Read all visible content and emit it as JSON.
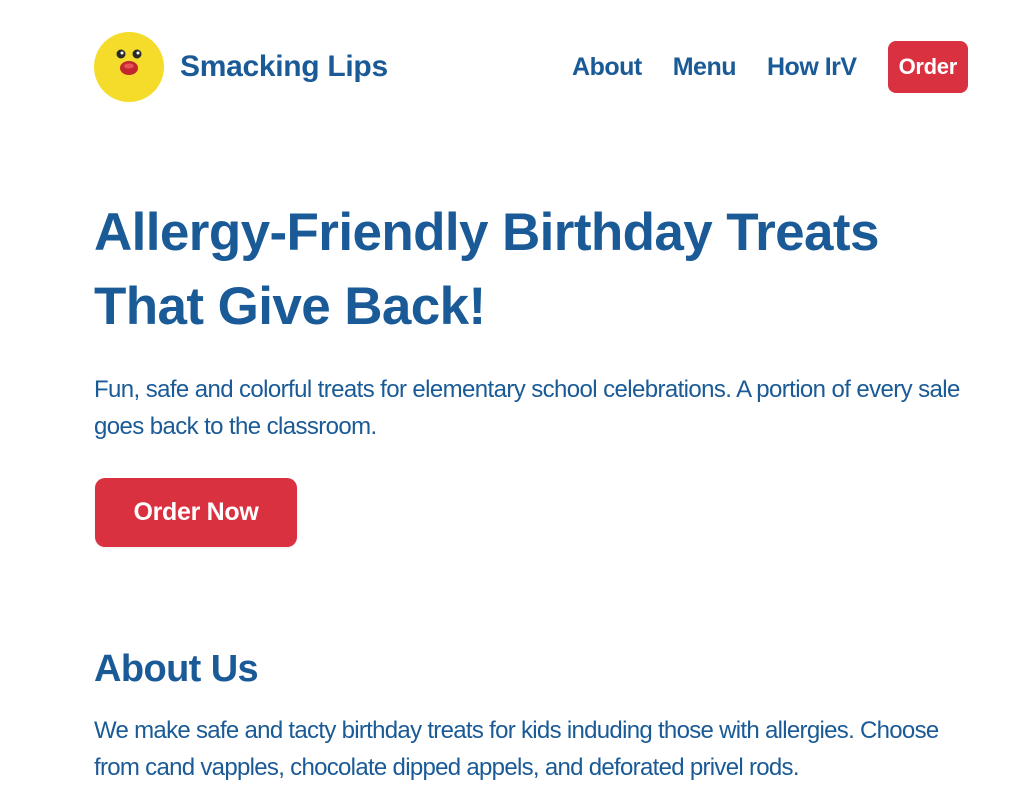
{
  "header": {
    "brand": "Smacking Lips",
    "logo_icon": "smiling-lips-face-icon",
    "nav": [
      {
        "label": "About"
      },
      {
        "label": "Menu"
      },
      {
        "label": "How IrV"
      }
    ],
    "order_label": "Order"
  },
  "hero": {
    "title": "Allergy-Friendly Birthday Treats That Give Back!",
    "subtitle": "Fun, safe and colorful treats for elementary school celebrations. A portion of every sale goes back to the classroom.",
    "cta_label": "Order Now"
  },
  "about": {
    "title": "About Us",
    "text": "We make safe and tacty birthday treats for kids induding those with allergies. Choose from cand vapples, chocolate dipped appels, and deforated privel rods."
  },
  "colors": {
    "primary": "#1a5a96",
    "accent": "#d9313f",
    "logo_bg": "#f5dc2a"
  }
}
